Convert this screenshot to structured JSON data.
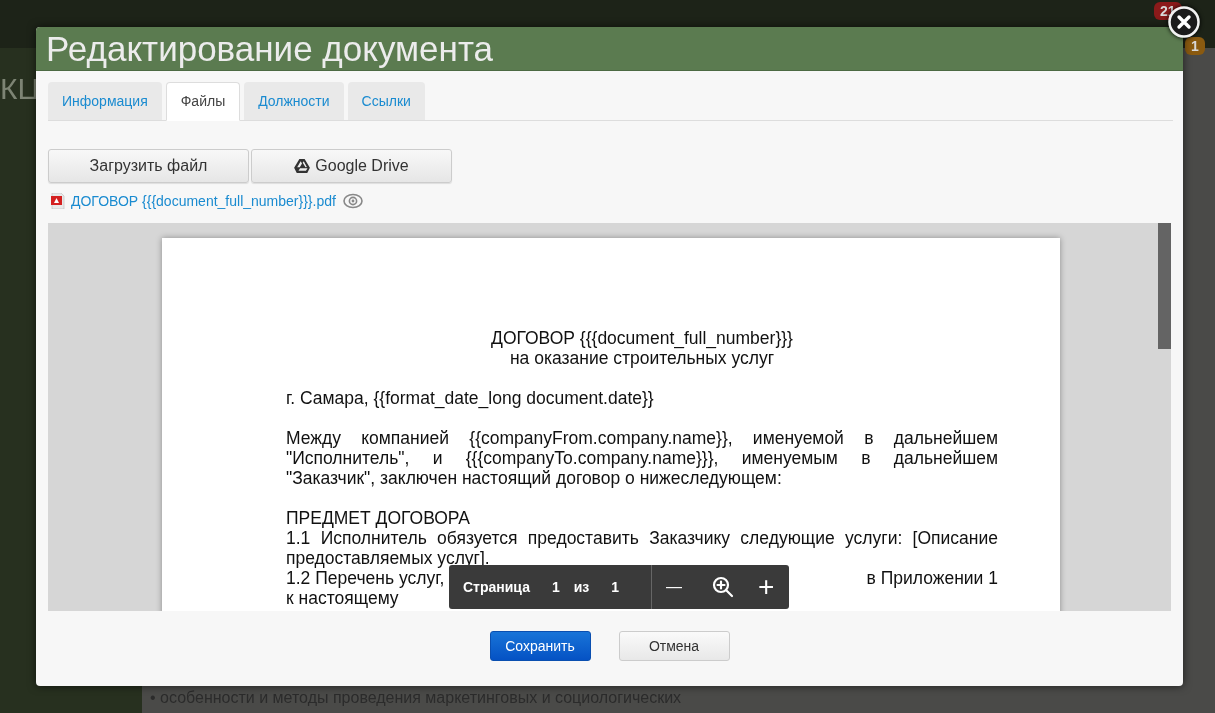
{
  "background": {
    "side_text": "КЦ",
    "badges": [
      {
        "text": "21",
        "color": "#8b1a1a"
      },
      {
        "text": "1",
        "color": "#8a5a10"
      }
    ],
    "bottom_text": "• особенности и методы проведения маркетинговых и социологических"
  },
  "dialog": {
    "title": "Редактирование документа",
    "tabs": [
      {
        "label": "Информация",
        "selected": false
      },
      {
        "label": "Файлы",
        "selected": true
      },
      {
        "label": "Должности",
        "selected": false
      },
      {
        "label": "Ссылки",
        "selected": false
      }
    ],
    "upload_buttons": [
      {
        "label": "Загрузить файл",
        "kind": "plain"
      },
      {
        "label": "Google Drive",
        "kind": "drive"
      }
    ],
    "file": {
      "name": "ДОГОВОР {{{document_full_number}}}.pdf"
    },
    "document": {
      "blocks": [
        {
          "kind": "title",
          "lines": [
            "ДОГОВОР {{{document_full_number}}}",
            "на оказание строительных услуг"
          ]
        },
        {
          "kind": "text",
          "text": "г. Самара, {{format_date_long document.date}}"
        },
        {
          "kind": "text",
          "text": "Между компанией {{companyFrom.company.name}}, именуемой в дальнейшем \"Исполнитель\", и {{{companyTo.company.name}}}, именуемым в дальнейшем \"Заказчик\", заключен настоящий договор о нижеследующем:"
        },
        {
          "kind": "section",
          "heading": "ПРЕДМЕТ ДОГОВОРА",
          "items": [
            "1.1 Исполнитель обязуется предоставить Заказчику следующие услуги: [Описание предоставляемых услуг]."
          ],
          "covered_item": {
            "start": "1.2 Перечень услуг,",
            "end": "в Приложении 1",
            "next_line": "к настоящему"
          }
        }
      ]
    },
    "viewer_toolbar": {
      "page_label": "Страница",
      "page": "1",
      "of_label": "из",
      "total": "1",
      "zoom_out": "—",
      "zoom_in": "+"
    },
    "footer_buttons": [
      {
        "label": "Сохранить",
        "kind": "primary"
      },
      {
        "label": "Отмена",
        "kind": "secondary"
      }
    ]
  }
}
